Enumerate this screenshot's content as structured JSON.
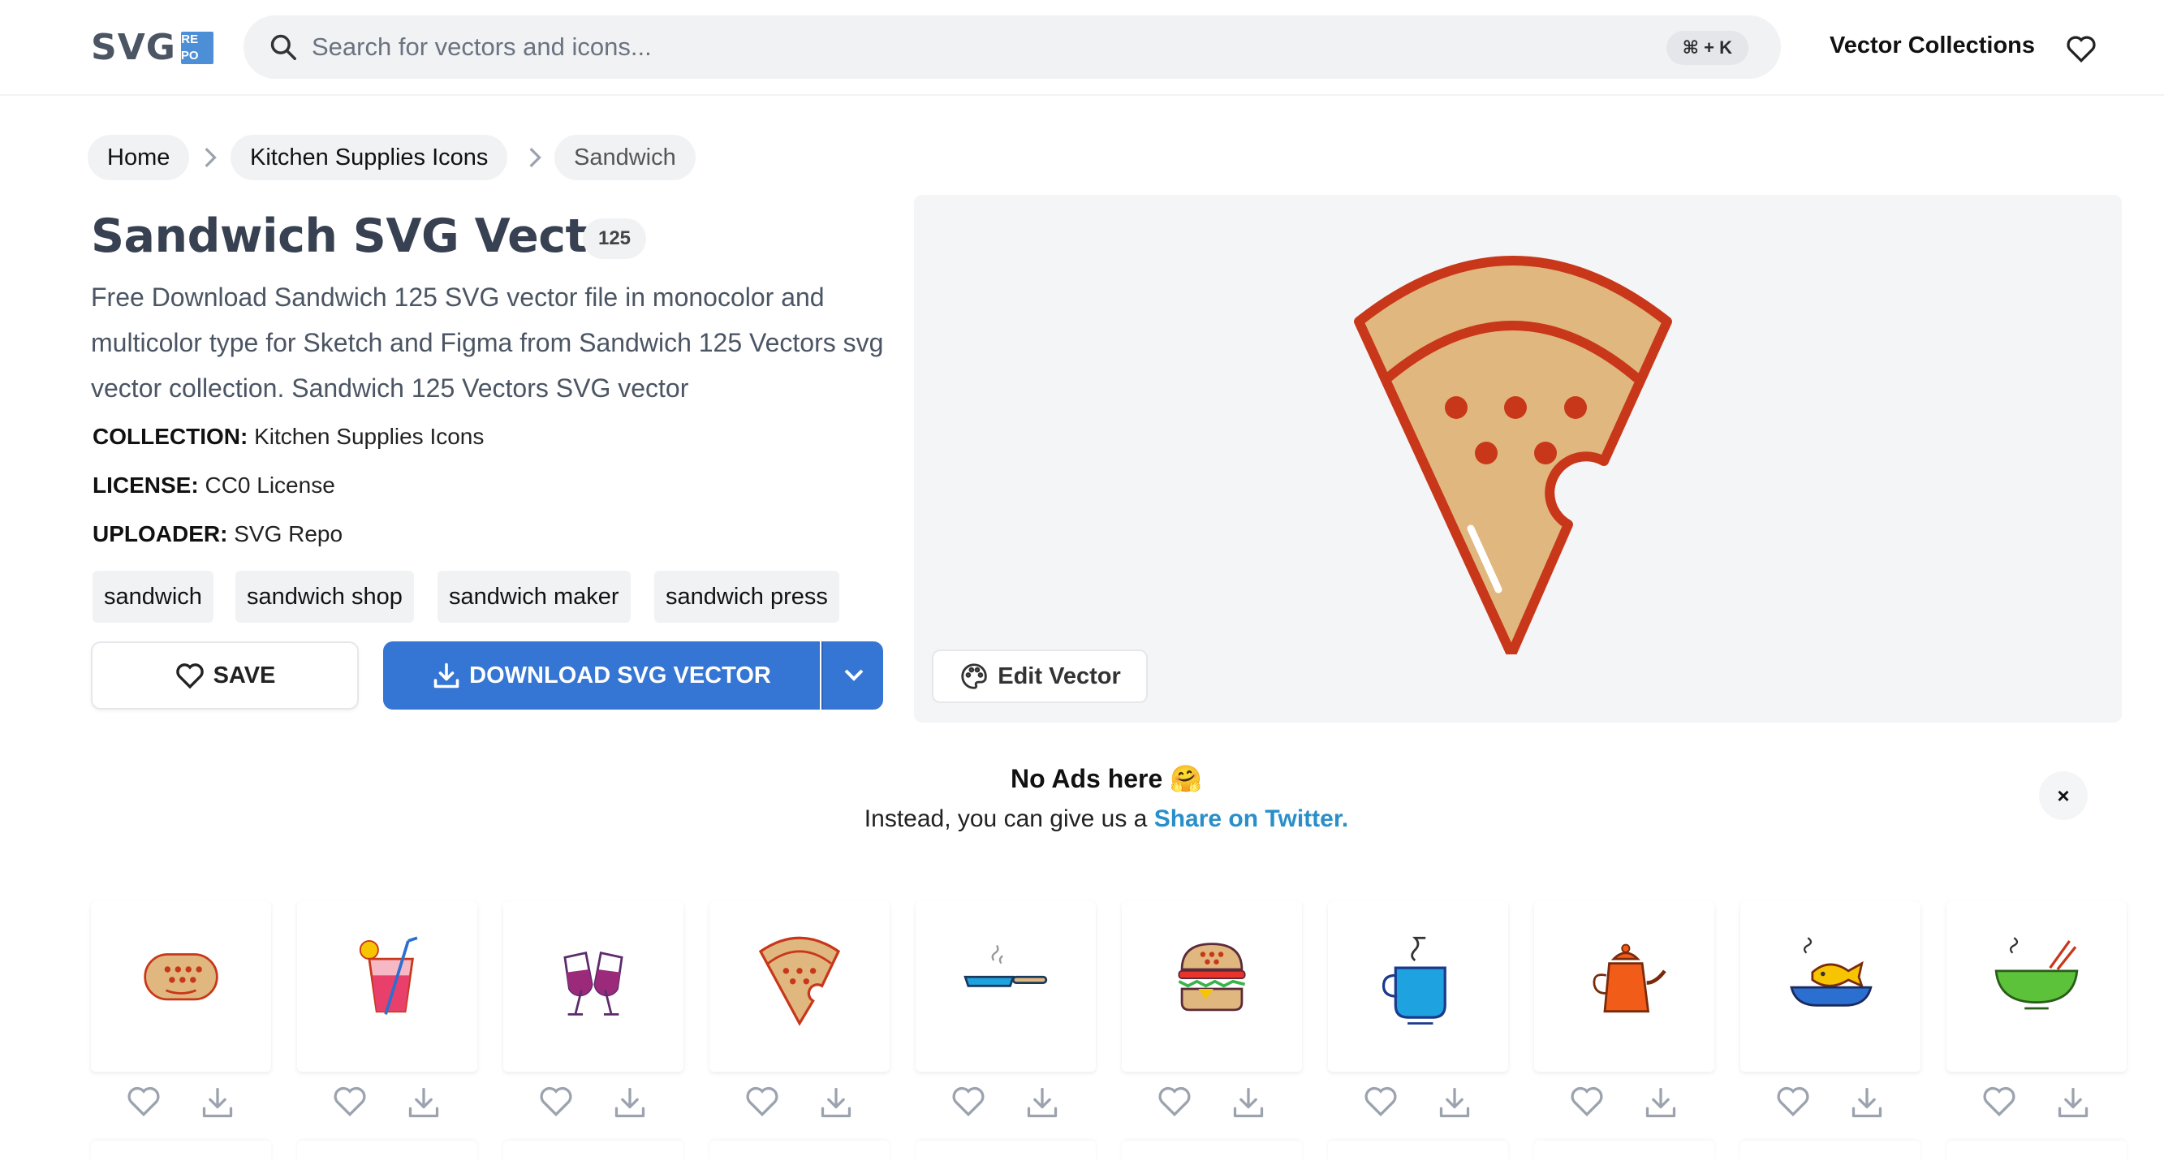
{
  "header": {
    "logo_text": "SVG",
    "logo_box": [
      "RE",
      "PO"
    ],
    "search_placeholder": "Search for vectors and icons...",
    "shortcut": "⌘ + K",
    "nav_link": "Vector Collections"
  },
  "breadcrumb": {
    "items": [
      "Home",
      "Kitchen Supplies Icons",
      "Sandwich"
    ]
  },
  "page": {
    "title": "Sandwich SVG Vector",
    "count": "125",
    "description": "Free Download Sandwich 125 SVG vector file in monocolor and multicolor type for Sketch and Figma from Sandwich 125 Vectors svg vector collection. Sandwich 125 Vectors SVG vector",
    "meta": [
      {
        "label": "COLLECTION:",
        "value": " Kitchen Supplies Icons"
      },
      {
        "label": "LICENSE:",
        "value": " CC0 License"
      },
      {
        "label": "UPLOADER:",
        "value": " SVG Repo"
      }
    ],
    "tags": [
      "sandwich",
      "sandwich shop",
      "sandwich maker",
      "sandwich press"
    ],
    "save_label": "SAVE",
    "download_label": "DOWNLOAD SVG VECTOR",
    "edit_label": "Edit Vector"
  },
  "colors": {
    "brand_blue": "#3575d3",
    "link_blue": "#2a8fc9",
    "pizza_crust": "#e0b77e",
    "pizza_outline": "#c8371a"
  },
  "banner": {
    "title": "No Ads here 🤗",
    "subtitle_prefix": "Instead, you can give us a ",
    "subtitle_link": "Share on Twitter.",
    "close": "×"
  },
  "related": [
    {
      "name": "bread-icon"
    },
    {
      "name": "cocktail-icon"
    },
    {
      "name": "wine-glasses-icon"
    },
    {
      "name": "pizza-slice-icon"
    },
    {
      "name": "frying-pan-icon"
    },
    {
      "name": "burger-icon"
    },
    {
      "name": "coffee-cup-icon"
    },
    {
      "name": "teapot-icon"
    },
    {
      "name": "fish-dish-icon"
    },
    {
      "name": "salad-bowl-icon"
    }
  ]
}
